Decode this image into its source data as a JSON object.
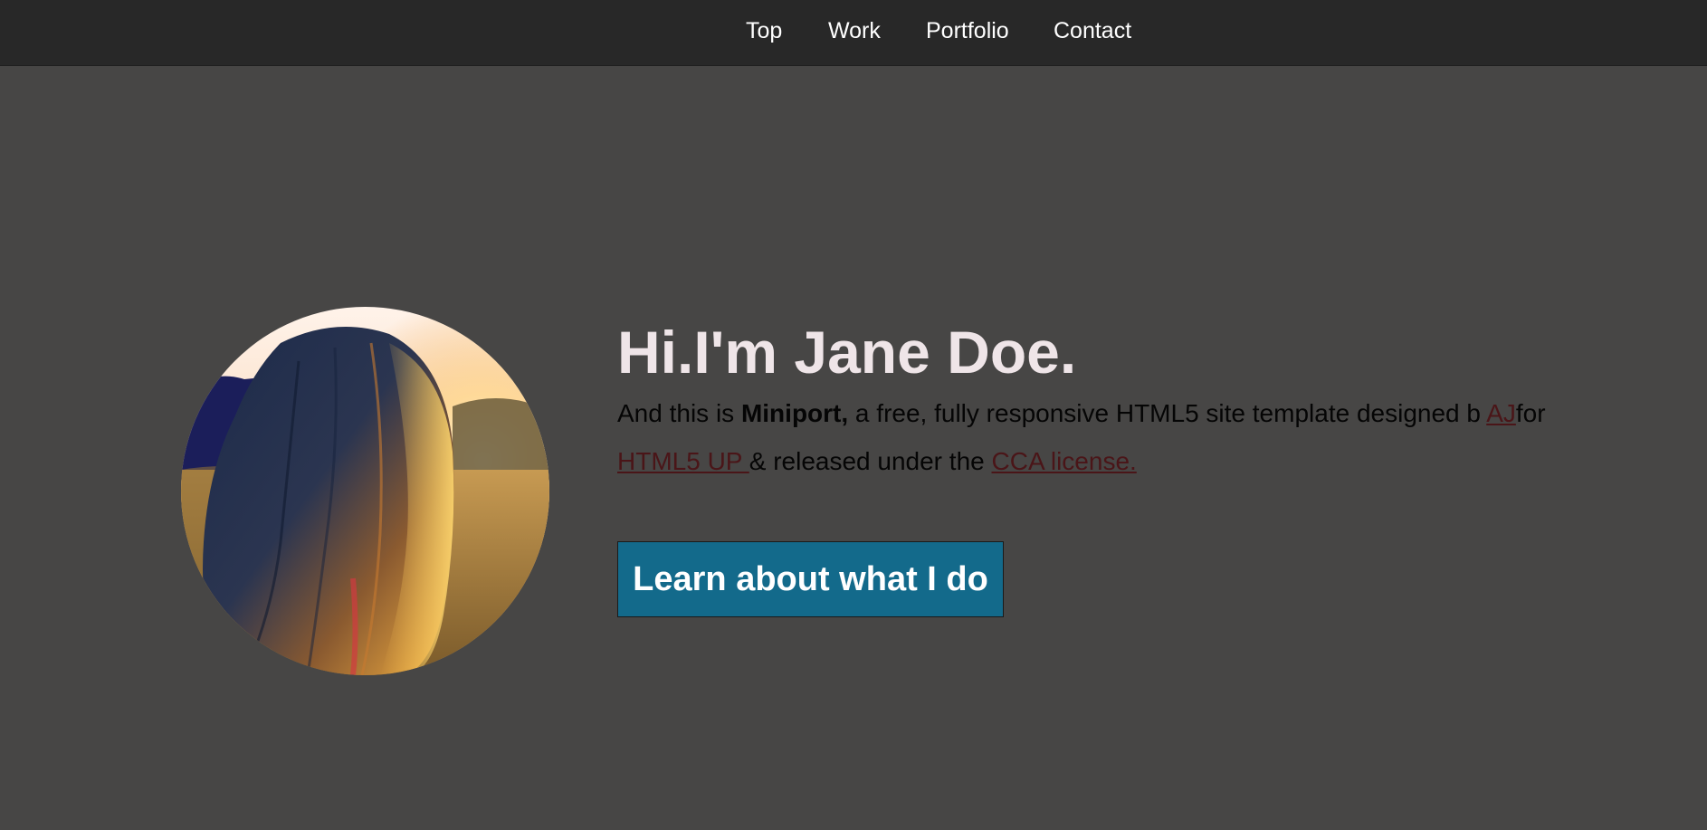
{
  "nav": {
    "items": [
      {
        "label": "Top"
      },
      {
        "label": "Work"
      },
      {
        "label": "Portfolio"
      },
      {
        "label": "Contact"
      }
    ]
  },
  "hero": {
    "greeting": "Hi.I'm Jane Doe.",
    "intro": {
      "lead": "And this is ",
      "brand": "Miniport,",
      "mid": " a free, fully responsive HTML5 site template designed b ",
      "author_link": "AJ",
      "for_text": "for ",
      "html5up_link": "HTML5 UP ",
      "released_text": "& released under the ",
      "license_link": "CCA license."
    },
    "cta_label": "Learn about what I do",
    "avatar_alt": "profile-photo"
  },
  "colors": {
    "page_bg": "#474645",
    "navbar_bg": "#282828",
    "headline": "#efe5e8",
    "link": "#4a1518",
    "cta_bg": "#136a8b"
  }
}
